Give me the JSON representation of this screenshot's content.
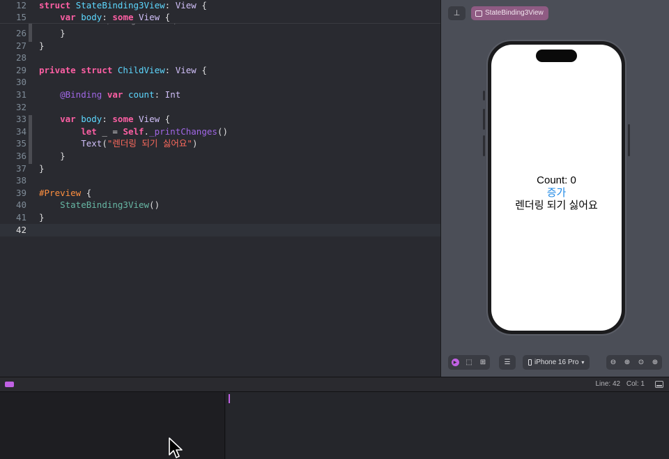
{
  "editor": {
    "sticky_lines": [
      {
        "num": "12",
        "tokens": [
          [
            "kw",
            "struct"
          ],
          [
            "pt",
            " "
          ],
          [
            "tn",
            "StateBinding3View"
          ],
          [
            "pt",
            ": "
          ],
          [
            "ty",
            "View"
          ],
          [
            "pt",
            " {"
          ]
        ]
      },
      {
        "num": "15",
        "tokens": [
          [
            "pt",
            "    "
          ],
          [
            "kw",
            "var"
          ],
          [
            "pt",
            " "
          ],
          [
            "tn",
            "body"
          ],
          [
            "pt",
            ": "
          ],
          [
            "kw",
            "some"
          ],
          [
            "pt",
            " "
          ],
          [
            "ty",
            "View"
          ],
          [
            "pt",
            " {"
          ]
        ]
      }
    ],
    "lines": [
      {
        "num": "26",
        "tokens": [
          [
            "pt",
            "    }"
          ]
        ]
      },
      {
        "num": "27",
        "tokens": [
          [
            "pt",
            "}"
          ]
        ]
      },
      {
        "num": "28",
        "tokens": []
      },
      {
        "num": "29",
        "tokens": [
          [
            "kw",
            "private"
          ],
          [
            "pt",
            " "
          ],
          [
            "kw",
            "struct"
          ],
          [
            "pt",
            " "
          ],
          [
            "tn",
            "ChildView"
          ],
          [
            "pt",
            ": "
          ],
          [
            "ty",
            "View"
          ],
          [
            "pt",
            " {"
          ]
        ]
      },
      {
        "num": "30",
        "tokens": []
      },
      {
        "num": "31",
        "tokens": [
          [
            "pt",
            "    "
          ],
          [
            "fn",
            "@Binding"
          ],
          [
            "pt",
            " "
          ],
          [
            "kw",
            "var"
          ],
          [
            "pt",
            " "
          ],
          [
            "tn",
            "count"
          ],
          [
            "pt",
            ": "
          ],
          [
            "ty",
            "Int"
          ]
        ]
      },
      {
        "num": "32",
        "tokens": []
      },
      {
        "num": "33",
        "tokens": [
          [
            "pt",
            "    "
          ],
          [
            "kw",
            "var"
          ],
          [
            "pt",
            " "
          ],
          [
            "tn",
            "body"
          ],
          [
            "pt",
            ": "
          ],
          [
            "kw",
            "some"
          ],
          [
            "pt",
            " "
          ],
          [
            "ty",
            "View"
          ],
          [
            "pt",
            " {"
          ]
        ]
      },
      {
        "num": "34",
        "tokens": [
          [
            "pt",
            "        "
          ],
          [
            "kw",
            "let"
          ],
          [
            "pt",
            " _ = "
          ],
          [
            "kw",
            "Self"
          ],
          [
            "pt",
            "."
          ],
          [
            "mc",
            "_printChanges"
          ],
          [
            "pt",
            "()"
          ]
        ]
      },
      {
        "num": "35",
        "tokens": [
          [
            "pt",
            "        "
          ],
          [
            "ty",
            "Text"
          ],
          [
            "pt",
            "("
          ],
          [
            "st",
            "\"렌더링 되기 싫어요\""
          ],
          [
            "pt",
            ")"
          ]
        ]
      },
      {
        "num": "36",
        "tokens": [
          [
            "pt",
            "    }"
          ]
        ]
      },
      {
        "num": "37",
        "tokens": [
          [
            "pt",
            "}"
          ]
        ]
      },
      {
        "num": "38",
        "tokens": []
      },
      {
        "num": "39",
        "tokens": [
          [
            "pp",
            "#Preview"
          ],
          [
            "pt",
            " {"
          ]
        ]
      },
      {
        "num": "40",
        "tokens": [
          [
            "pt",
            "    "
          ],
          [
            "cv",
            "StateBinding3View"
          ],
          [
            "pt",
            "()"
          ]
        ]
      },
      {
        "num": "41",
        "tokens": [
          [
            "pt",
            "}"
          ]
        ]
      },
      {
        "num": "42",
        "tokens": [],
        "current": true
      }
    ]
  },
  "canvas": {
    "pin_icon": "pin-icon",
    "preview_chip_label": "StateBinding3View",
    "device_name": "iPhone 16 Pro",
    "screen": {
      "count_label": "Count: 0",
      "increment_button": "증가",
      "child_text": "렌더링 되기 싫어요"
    },
    "toolbar": {
      "left_icons": [
        "live-preview-icon",
        "selectable-icon",
        "variants-grid-icon"
      ],
      "settings_icon": "device-settings-icon",
      "zoom_icons": [
        "zoom-out-icon",
        "zoom-in-icon",
        "zoom-to-fit-icon",
        "zoom-actual-icon"
      ]
    }
  },
  "status": {
    "line": "Line: 42",
    "col": "Col: 1"
  },
  "colors": {
    "accent": "#c161e4",
    "link": "#1f88e5",
    "editor_bg": "#292a30"
  }
}
